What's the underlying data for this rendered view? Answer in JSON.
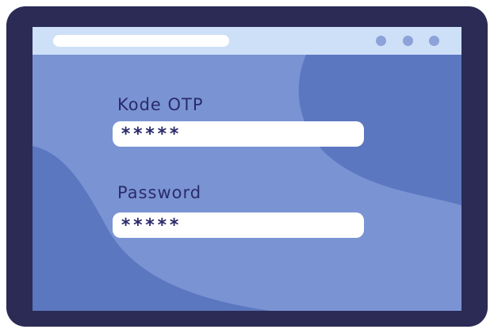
{
  "browser": {
    "window_controls": [
      "dot",
      "dot",
      "dot"
    ]
  },
  "form": {
    "otp": {
      "label": "Kode OTP",
      "value": "*****"
    },
    "password": {
      "label": "Password",
      "value": "*****"
    }
  },
  "colors": {
    "device_frame": "#2b2b55",
    "screen_bg": "#7a93d3",
    "screen_shape": "#5b77c0",
    "browser_bar": "#cde0f8",
    "window_dot": "#8ca2d8",
    "text": "#2b2b6b"
  }
}
